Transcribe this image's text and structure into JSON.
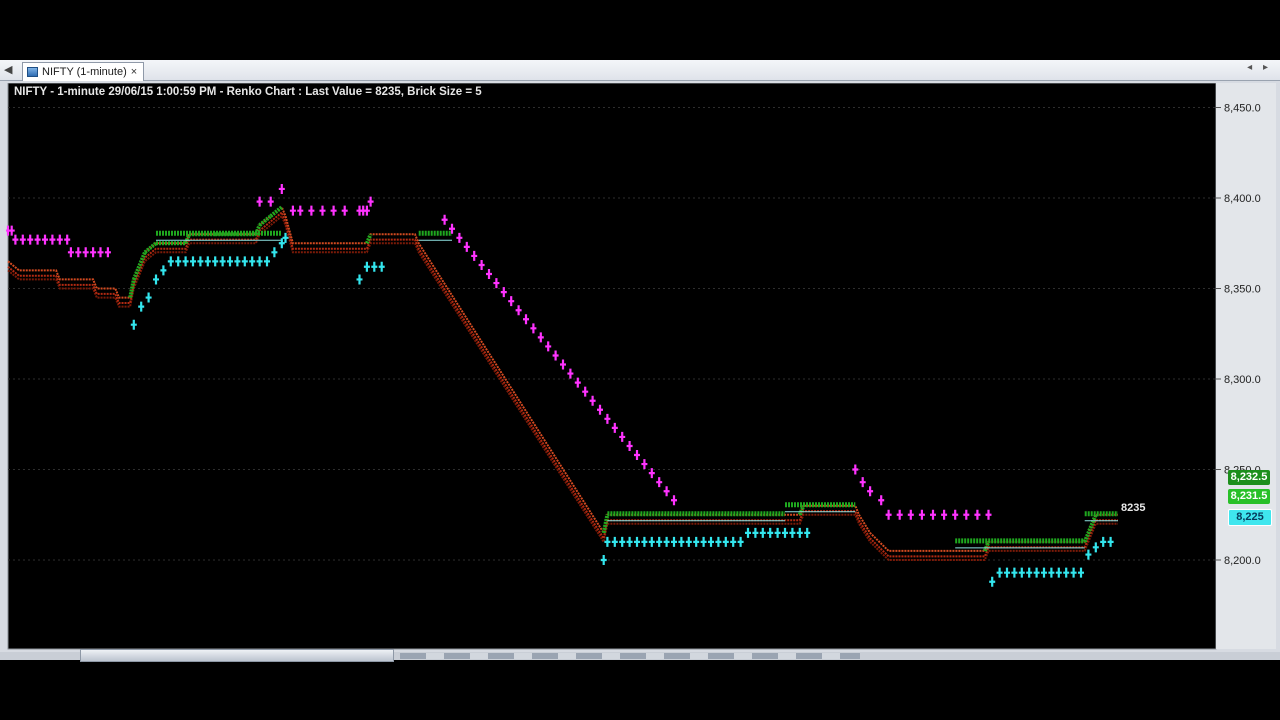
{
  "tab": {
    "label": "NIFTY (1-minute)",
    "close": "×"
  },
  "chart_data": {
    "type": "line",
    "title": "NIFTY - 1-minute 29/06/15 1:00:59 PM - Renko Chart : Last Value = 8235, Brick Size = 5",
    "ylim": [
      8170,
      8460
    ],
    "y_ticks": [
      8200,
      8250,
      8300,
      8350,
      8400,
      8450
    ],
    "y_tick_labels": [
      "8,200.0",
      "8,250.0",
      "8,300.0",
      "8,350.0",
      "8,400.0",
      "8,450.0"
    ],
    "grid": true,
    "brick_size": 5,
    "x_count": 187,
    "colors": {
      "up_brick": "#1fa81f",
      "down_brick": "#b22a12",
      "sell_marker": "#ff33ff",
      "buy_marker": "#33e6ee",
      "background": "#000000",
      "grid": "#2e2e2e"
    },
    "brick_path": [
      [
        0,
        8365
      ],
      [
        3,
        8360
      ],
      [
        13,
        8360
      ],
      [
        14,
        8355
      ],
      [
        23,
        8355
      ],
      [
        24,
        8350
      ],
      [
        29,
        8350
      ],
      [
        30,
        8345
      ],
      [
        33,
        8345
      ],
      [
        34,
        8355
      ],
      [
        37,
        8370
      ],
      [
        40,
        8375
      ],
      [
        48,
        8375
      ],
      [
        49,
        8380
      ],
      [
        56,
        8380
      ],
      [
        62,
        8380
      ],
      [
        67,
        8380
      ],
      [
        68,
        8385
      ],
      [
        71,
        8390
      ],
      [
        74,
        8395
      ],
      [
        75,
        8390
      ],
      [
        77,
        8375
      ],
      [
        79,
        8375
      ],
      [
        82,
        8375
      ],
      [
        85,
        8375
      ],
      [
        88,
        8375
      ],
      [
        91,
        8375
      ],
      [
        95,
        8375
      ],
      [
        96,
        8375
      ],
      [
        97,
        8375
      ],
      [
        98,
        8380
      ],
      [
        110,
        8380
      ],
      [
        111,
        8375
      ],
      [
        161,
        8215
      ],
      [
        162,
        8225
      ],
      [
        186,
        8225
      ],
      [
        187,
        8225
      ],
      [
        214,
        8225
      ],
      [
        215,
        8230
      ],
      [
        229,
        8230
      ],
      [
        230,
        8225
      ],
      [
        233,
        8215
      ],
      [
        238,
        8205
      ],
      [
        256,
        8205
      ],
      [
        264,
        8205
      ],
      [
        265,
        8210
      ],
      [
        291,
        8210
      ],
      [
        294,
        8225
      ],
      [
        300,
        8225
      ]
    ],
    "series": [
      {
        "name": "",
        "values": [
          [
            0,
            8382
          ],
          [
            1,
            8382
          ],
          [
            2,
            8377
          ],
          [
            4,
            8377
          ],
          [
            6,
            8377
          ],
          [
            8,
            8377
          ],
          [
            10,
            8377
          ],
          [
            12,
            8377
          ],
          [
            14,
            8377
          ],
          [
            16,
            8377
          ],
          [
            17,
            8370
          ],
          [
            19,
            8370
          ],
          [
            21,
            8370
          ],
          [
            23,
            8370
          ],
          [
            25,
            8370
          ],
          [
            27,
            8370
          ],
          [
            68,
            8398
          ],
          [
            71,
            8398
          ],
          [
            74,
            8405
          ],
          [
            77,
            8393
          ],
          [
            79,
            8393
          ],
          [
            82,
            8393
          ],
          [
            85,
            8393
          ],
          [
            88,
            8393
          ],
          [
            91,
            8393
          ],
          [
            95,
            8393
          ],
          [
            96,
            8393
          ],
          [
            97,
            8393
          ],
          [
            98,
            8398
          ],
          [
            118,
            8388
          ],
          [
            120,
            8383
          ],
          [
            122,
            8378
          ],
          [
            124,
            8373
          ],
          [
            126,
            8368
          ],
          [
            128,
            8363
          ],
          [
            130,
            8358
          ],
          [
            132,
            8353
          ],
          [
            134,
            8348
          ],
          [
            136,
            8343
          ],
          [
            138,
            8338
          ],
          [
            140,
            8333
          ],
          [
            142,
            8328
          ],
          [
            144,
            8323
          ],
          [
            146,
            8318
          ],
          [
            148,
            8313
          ],
          [
            150,
            8308
          ],
          [
            152,
            8303
          ],
          [
            154,
            8298
          ],
          [
            156,
            8293
          ],
          [
            158,
            8288
          ],
          [
            160,
            8283
          ],
          [
            162,
            8278
          ],
          [
            164,
            8273
          ],
          [
            166,
            8268
          ],
          [
            168,
            8263
          ],
          [
            170,
            8258
          ],
          [
            172,
            8253
          ],
          [
            174,
            8248
          ],
          [
            176,
            8243
          ],
          [
            178,
            8238
          ],
          [
            180,
            8233
          ],
          [
            229,
            8250
          ],
          [
            231,
            8243
          ],
          [
            233,
            8238
          ],
          [
            236,
            8233
          ],
          [
            238,
            8225
          ],
          [
            241,
            8225
          ],
          [
            244,
            8225
          ],
          [
            247,
            8225
          ],
          [
            250,
            8225
          ],
          [
            253,
            8225
          ],
          [
            256,
            8225
          ],
          [
            259,
            8225
          ],
          [
            262,
            8225
          ],
          [
            265,
            8225
          ]
        ]
      },
      {
        "name": "",
        "values": [
          [
            34,
            8330
          ],
          [
            36,
            8340
          ],
          [
            38,
            8345
          ],
          [
            40,
            8355
          ],
          [
            42,
            8360
          ],
          [
            44,
            8365
          ],
          [
            46,
            8365
          ],
          [
            48,
            8365
          ],
          [
            50,
            8365
          ],
          [
            52,
            8365
          ],
          [
            54,
            8365
          ],
          [
            56,
            8365
          ],
          [
            58,
            8365
          ],
          [
            60,
            8365
          ],
          [
            62,
            8365
          ],
          [
            64,
            8365
          ],
          [
            66,
            8365
          ],
          [
            68,
            8365
          ],
          [
            70,
            8365
          ],
          [
            72,
            8370
          ],
          [
            74,
            8375
          ],
          [
            75,
            8378
          ],
          [
            95,
            8355
          ],
          [
            97,
            8362
          ],
          [
            99,
            8362
          ],
          [
            101,
            8362
          ],
          [
            161,
            8200
          ],
          [
            162,
            8210
          ],
          [
            164,
            8210
          ],
          [
            166,
            8210
          ],
          [
            168,
            8210
          ],
          [
            170,
            8210
          ],
          [
            172,
            8210
          ],
          [
            174,
            8210
          ],
          [
            176,
            8210
          ],
          [
            178,
            8210
          ],
          [
            180,
            8210
          ],
          [
            182,
            8210
          ],
          [
            184,
            8210
          ],
          [
            186,
            8210
          ],
          [
            188,
            8210
          ],
          [
            190,
            8210
          ],
          [
            192,
            8210
          ],
          [
            194,
            8210
          ],
          [
            196,
            8210
          ],
          [
            198,
            8210
          ],
          [
            200,
            8215
          ],
          [
            202,
            8215
          ],
          [
            204,
            8215
          ],
          [
            206,
            8215
          ],
          [
            208,
            8215
          ],
          [
            210,
            8215
          ],
          [
            212,
            8215
          ],
          [
            214,
            8215
          ],
          [
            216,
            8215
          ],
          [
            266,
            8188
          ],
          [
            268,
            8193
          ],
          [
            270,
            8193
          ],
          [
            272,
            8193
          ],
          [
            274,
            8193
          ],
          [
            276,
            8193
          ],
          [
            278,
            8193
          ],
          [
            280,
            8193
          ],
          [
            282,
            8193
          ],
          [
            284,
            8193
          ],
          [
            286,
            8193
          ],
          [
            288,
            8193
          ],
          [
            290,
            8193
          ],
          [
            292,
            8203
          ],
          [
            294,
            8207
          ],
          [
            296,
            8210
          ],
          [
            298,
            8210
          ]
        ]
      }
    ],
    "price_tags": [
      "8,232.5",
      "8,231.5",
      "8,225"
    ],
    "last_value_label": "8235"
  }
}
